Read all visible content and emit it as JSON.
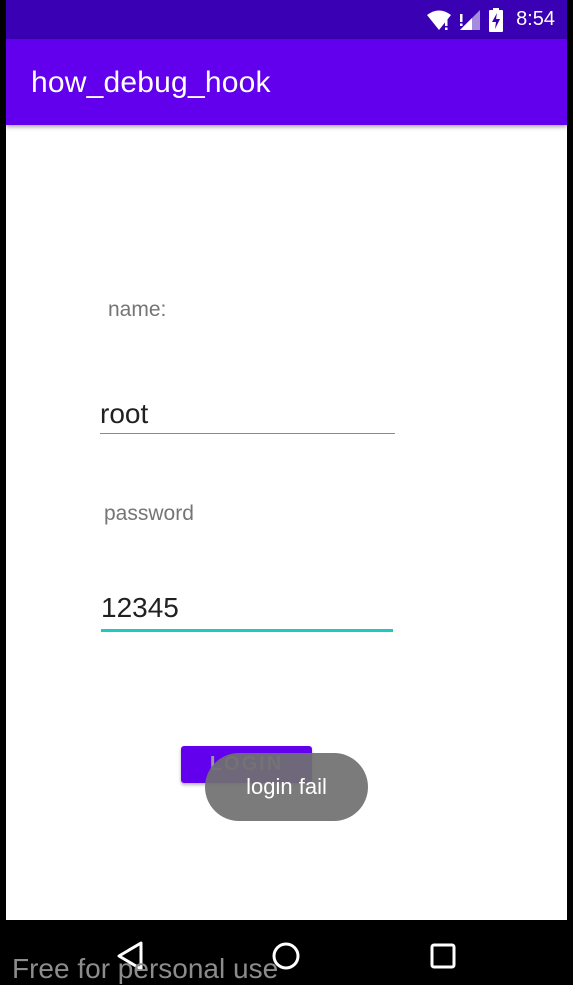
{
  "status_bar": {
    "time": "8:54",
    "icons": [
      "wifi-icon",
      "signal-icon",
      "battery-charging-icon"
    ]
  },
  "app_bar": {
    "title": "how_debug_hook"
  },
  "form": {
    "name_label": "name:",
    "name_value": "root",
    "password_label": "password",
    "password_value": "12345",
    "login_label": "LOGIN"
  },
  "toast": {
    "message": "login fail"
  },
  "nav_bar": {
    "icons": [
      "back-icon",
      "home-icon",
      "recents-icon"
    ]
  },
  "watermark": "Free for personal use",
  "colors": {
    "primary": "#6200ee",
    "primary_dark": "#3a00b3",
    "accent": "#1ec9c0"
  }
}
